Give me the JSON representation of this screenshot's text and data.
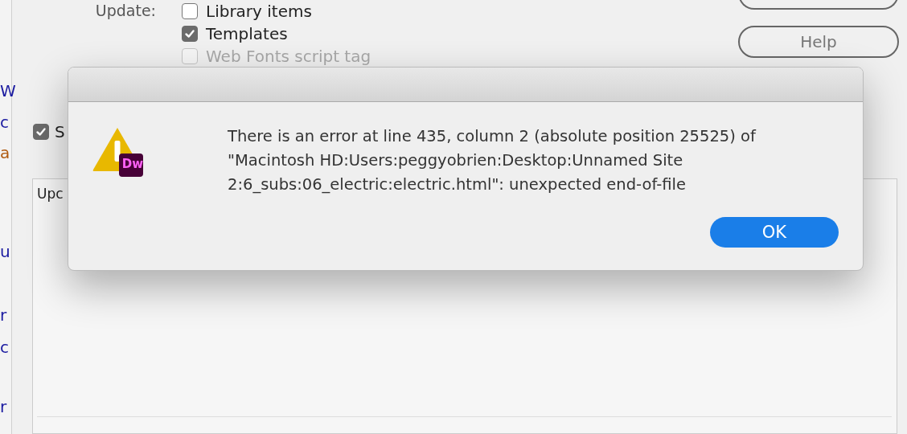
{
  "background_window": {
    "update_label": "Update:",
    "update_options": [
      {
        "label": "Library items",
        "checked": false,
        "disabled": false
      },
      {
        "label": "Templates",
        "checked": true,
        "disabled": false
      },
      {
        "label": "Web Fonts script tag",
        "checked": false,
        "disabled": true
      }
    ],
    "buttons": [
      "Help"
    ],
    "option": {
      "label": "S",
      "checked": true
    },
    "panel": {
      "text": "Upc"
    },
    "edge_fragments": [
      {
        "text": "W",
        "color": "#1a1aa0"
      },
      {
        "text": "c",
        "color": "#1a1aa0"
      },
      {
        "text": "a",
        "color": "#b05a10"
      },
      {
        "text": "u",
        "color": "#1a1aa0"
      },
      {
        "text": "r",
        "color": "#1a1aa0"
      },
      {
        "text": "c",
        "color": "#1a1aa0"
      },
      {
        "text": "r",
        "color": "#1a1aa0"
      }
    ]
  },
  "alert": {
    "message": "There is an error at line 435, column 2 (absolute position 25525) of \"Macintosh HD:Users:peggyobrien:Desktop:Unnamed Site 2:6_subs:06_electric:electric.html\": unexpected end-of-file",
    "badge": "Dw",
    "buttons": [
      {
        "label": "OK",
        "default": true
      }
    ]
  }
}
